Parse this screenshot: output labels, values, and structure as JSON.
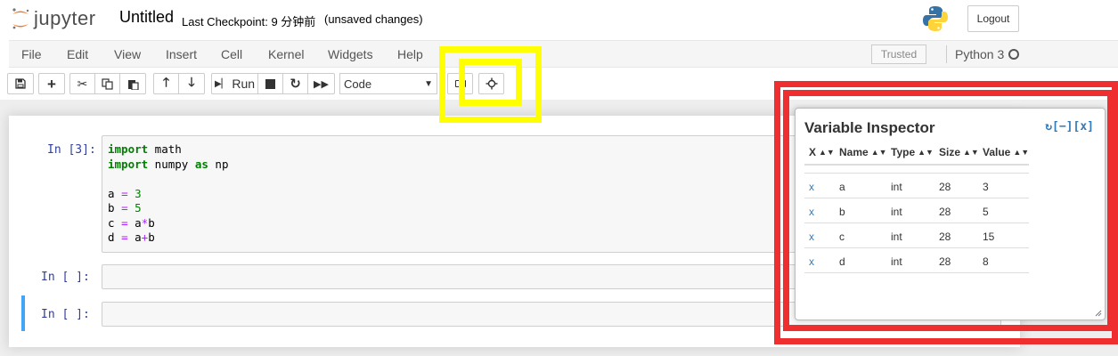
{
  "header": {
    "logo_text": "jupyter",
    "notebook_name": "Untitled",
    "checkpoint": "Last Checkpoint: 9 分钟前",
    "autosave_status": "(unsaved changes)",
    "logout_label": "Logout"
  },
  "menubar": {
    "items": [
      "File",
      "Edit",
      "View",
      "Insert",
      "Cell",
      "Kernel",
      "Widgets",
      "Help"
    ],
    "trusted_label": "Trusted",
    "kernel_name": "Python 3"
  },
  "toolbar": {
    "run_label": "Run",
    "cell_type": "Code",
    "icons": [
      "save-icon",
      "plus-icon",
      "cut-icon",
      "copy-icon",
      "paste-icon",
      "arrow-up-icon",
      "arrow-down-icon",
      "run-icon",
      "stop-icon",
      "restart-icon",
      "fast-forward-icon",
      "keyboard-icon",
      "crosshair-icon"
    ]
  },
  "cells": [
    {
      "prompt": "In  [3]:",
      "lines": [
        [
          {
            "t": "import",
            "c": "kw"
          },
          {
            "t": " math",
            "c": ""
          }
        ],
        [
          {
            "t": "import",
            "c": "kw"
          },
          {
            "t": " numpy ",
            "c": ""
          },
          {
            "t": "as",
            "c": "kw"
          },
          {
            "t": " np",
            "c": ""
          }
        ],
        [],
        [
          {
            "t": "a ",
            "c": ""
          },
          {
            "t": "=",
            "c": "op"
          },
          {
            "t": " ",
            "c": ""
          },
          {
            "t": "3",
            "c": "num"
          }
        ],
        [
          {
            "t": "b ",
            "c": ""
          },
          {
            "t": "=",
            "c": "op"
          },
          {
            "t": " ",
            "c": ""
          },
          {
            "t": "5",
            "c": "num"
          }
        ],
        [
          {
            "t": "c ",
            "c": ""
          },
          {
            "t": "=",
            "c": "op"
          },
          {
            "t": " a",
            "c": ""
          },
          {
            "t": "*",
            "c": "op"
          },
          {
            "t": "b",
            "c": ""
          }
        ],
        [
          {
            "t": "d ",
            "c": ""
          },
          {
            "t": "=",
            "c": "op"
          },
          {
            "t": " a",
            "c": ""
          },
          {
            "t": "+",
            "c": "op"
          },
          {
            "t": "b",
            "c": ""
          }
        ]
      ]
    },
    {
      "prompt": "In  [ ]:",
      "lines": []
    },
    {
      "prompt": "In  [ ]:",
      "lines": []
    }
  ],
  "variable_inspector": {
    "title": "Variable Inspector",
    "controls": "↻[−][x]",
    "columns": [
      "X",
      "Name",
      "Type",
      "Size",
      "Value"
    ],
    "rows": [
      {
        "del": "x",
        "name": "a",
        "type": "int",
        "size": "28",
        "value": "3"
      },
      {
        "del": "x",
        "name": "b",
        "type": "int",
        "size": "28",
        "value": "5"
      },
      {
        "del": "x",
        "name": "c",
        "type": "int",
        "size": "28",
        "value": "15"
      },
      {
        "del": "x",
        "name": "d",
        "type": "int",
        "size": "28",
        "value": "8"
      }
    ]
  },
  "colors": {
    "highlight_yellow": "#ffff00",
    "highlight_red": "#ef2f2f",
    "prompt_blue": "#303f9f",
    "selected_cell_bar": "#42a5f5",
    "link_blue": "#337ab7"
  }
}
